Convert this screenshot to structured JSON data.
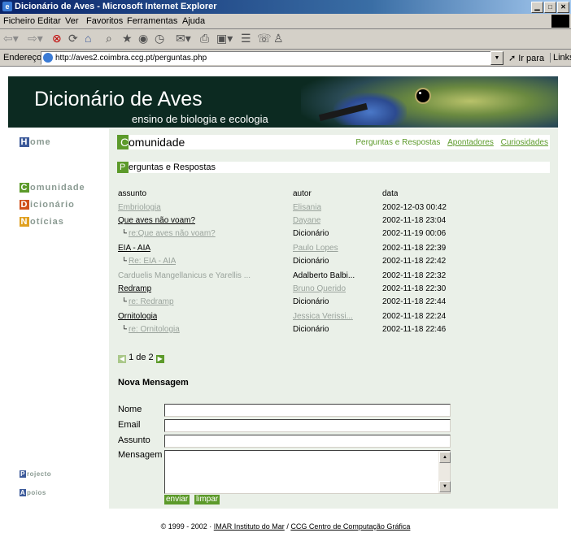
{
  "window": {
    "title": "Dicionário de Aves - Microsoft Internet Explorer"
  },
  "menu": [
    "Ficheiro",
    "Editar",
    "Ver",
    "Favoritos",
    "Ferramentas",
    "Ajuda"
  ],
  "address": {
    "label": "Endereço",
    "url": "http://aves2.coimbra.ccg.pt/perguntas.php",
    "go": "Ir para",
    "links": "Links"
  },
  "banner": {
    "title": "Dicionário de Aves",
    "subtitle": "ensino de biologia e ecologia"
  },
  "sidebar": {
    "items": [
      {
        "cap": "H",
        "rest": "ome",
        "color": "#3c5a9a"
      },
      {
        "cap": "C",
        "rest": "omunidade",
        "color": "#5c9a2a"
      },
      {
        "cap": "D",
        "rest": "icionário",
        "color": "#d0501a"
      },
      {
        "cap": "N",
        "rest": "otícias",
        "color": "#e0a020"
      }
    ],
    "bottom": [
      {
        "cap": "P",
        "rest": "rojecto",
        "color": "#3c5a9a"
      },
      {
        "cap": "A",
        "rest": "poios",
        "color": "#3c5a9a"
      }
    ]
  },
  "content": {
    "title_cap": "C",
    "title_rest": "omunidade",
    "links": [
      "Perguntas e Respostas",
      "Apontadores",
      "Curiosidades"
    ],
    "section_cap": "P",
    "section_rest": "erguntas e Respostas",
    "columns": [
      "assunto",
      "autor",
      "data"
    ],
    "rows": [
      {
        "assunto": "Embriologia",
        "autor": "Elisania",
        "data": "2002-12-03 00:42"
      },
      {
        "assunto": "Que aves não voam?",
        "autor": "Dayane",
        "data": "2002-11-18 23:04"
      },
      {
        "assunto": "re:Que aves não voam?",
        "autor": "Dicionário",
        "data": "2002-11-19 00:06"
      },
      {
        "assunto": "EIA - AIA",
        "autor": "Paulo Lopes",
        "data": "2002-11-18 22:39"
      },
      {
        "assunto": "Re: EIA - AIA",
        "autor": "Dicionário",
        "data": "2002-11-18 22:42"
      },
      {
        "assunto": "Carduelis Mangellanicus e Yarellis ...",
        "autor": "Adalberto Balbi...",
        "data": "2002-11-18 22:32"
      },
      {
        "assunto": "Redramp",
        "autor": "Bruno Querido",
        "data": "2002-11-18 22:30"
      },
      {
        "assunto": "re: Redramp",
        "autor": "Dicionário",
        "data": "2002-11-18 22:44"
      },
      {
        "assunto": "Ornitologia",
        "autor": "Jessica Verissi...",
        "data": "2002-11-18 22:24"
      },
      {
        "assunto": "re: Ornitologia",
        "autor": "Dicionário",
        "data": "2002-11-18 22:46"
      }
    ],
    "pager": "1 de 2",
    "form": {
      "title": "Nova Mensagem",
      "nome_label": "Nome",
      "email_label": "Email",
      "assunto_label": "Assunto",
      "mensagem_label": "Mensagem",
      "nome_value": "",
      "email_value": "",
      "assunto_value": "",
      "submit": "enviar",
      "clear": "limpar"
    }
  },
  "footer": {
    "copyright": "© 1999 - 2002 ·",
    "imar": "IMAR Instituto do Mar",
    "sep": "/",
    "ccg": "CCG Centro de Computação Gráfica"
  }
}
